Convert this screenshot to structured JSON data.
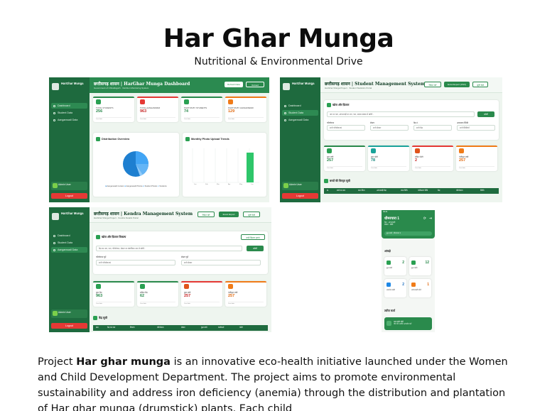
{
  "title": "Har Ghar Munga",
  "subtitle": "Nutritional & Environmental Drive",
  "colors": {
    "primary": "#2a8a4c",
    "sidebar": "#1e6a3e",
    "danger": "#e53935",
    "teal": "#1aa39a",
    "orange": "#f07b18",
    "blue": "#1e88e5"
  },
  "sidebar": {
    "brand": "HarGhar Munga",
    "brand_sub": "Admin Panel",
    "items": [
      "Dashboard",
      "Student Data",
      "Aanganwadi Data"
    ],
    "user_name": "Admin User",
    "user_role": "System Administrator",
    "logout": "Logout"
  },
  "shot1": {
    "title": "छत्तीसगढ़ शासन | HarGhar Munga Dashboard",
    "subtitle": "Government of Chhattisgarh · Nutrition Monitoring System",
    "btn_refresh": "Refresh Data",
    "btn_reload": "Reload",
    "stats": [
      {
        "label": "TOTAL STUDENTS",
        "value": "256"
      },
      {
        "label": "TOTAL AANGANWADI",
        "value": "963"
      },
      {
        "label": "PHOTOS BY STUDENTS",
        "value": "74"
      },
      {
        "label": "PHOTOS BY AANGANWADI",
        "value": "129"
      }
    ],
    "stat_foot": "Live data",
    "dist_title": "Distribution Overview",
    "legend": [
      "Aanganwadi Centers",
      "Aanganwadi Photos",
      "Student Photos",
      "Students"
    ],
    "trend_title": "Monthly Photo Upload Trends",
    "months": [
      "Jan",
      "Feb",
      "Mar",
      "Apr",
      "May",
      "Jun"
    ]
  },
  "shot2": {
    "title": "छत्तीसगढ़ शासन | Student Management System",
    "subtitle": "HarGhar Munga Project · Student Statistics Portal",
    "btn_refresh": "रिफ्रेश करें",
    "btn_export": "Excel Export (CSV)",
    "btn_list": "सूची देखें",
    "filter_title": "खोज और फ़िल्टर",
    "search_placeholder": "नाम या पता, आंगनवाड़ी या नाम, पता, सदस्य संख्या से खोजें...",
    "search_btn": "खोजें",
    "filters": [
      {
        "label": "परियोजना",
        "value": "सभी परियोजनाएं"
      },
      {
        "label": "सेक्टर",
        "value": "सभी सेक्टर"
      },
      {
        "label": "केंद्र नं.",
        "value": "सभी केंद्र"
      },
      {
        "label": "आवश्यक स्थिति",
        "value": "सभी स्थितियाँ"
      }
    ],
    "stats": [
      {
        "label": "कुल बच्चे",
        "value": "257"
      },
      {
        "label": "कुल फोटो",
        "value": "78"
      },
      {
        "label": "लंबित फोटो",
        "value": "2"
      },
      {
        "label": "पंजीकृत बच्चे",
        "value": "257"
      }
    ],
    "stat_foot": "Live data",
    "table_title": "बच्चों की विस्तृत सूची",
    "columns": [
      "क्र.",
      "बच्चे का नाम",
      "माता पिता",
      "आंगनवाड़ी केंद्र",
      "जन्म तिथि",
      "पंजीकरण तिथि",
      "केंद्र",
      "परियोजना",
      "स्थिति"
    ]
  },
  "shot3": {
    "title": "छत्तीसगढ़ शासन | Kendra Management System",
    "subtitle": "HarGhar Munga Project · Kendra Details Portal",
    "btn_refresh": "रिफ्रेश करें",
    "btn_export": "Excel Export",
    "btn_list": "सूची देखें",
    "filter_title": "खोज और फ़िल्टर विकल्प",
    "filter_btn": "सभी फ़िल्टर हटाएं",
    "search_placeholder": "केंद्र का नाम, पता, परियोजना, सेक्टर या संचालिका नाम से खोजें...",
    "search_btn": "खोजें",
    "filters": [
      {
        "label": "परियोजना चुनें",
        "value": "सभी परियोजनाएं"
      },
      {
        "label": "सेक्टर चुनें",
        "value": "सभी सेक्टर"
      }
    ],
    "stats": [
      {
        "label": "कुल केंद्र",
        "value": "963"
      },
      {
        "label": "सक्रिय केंद्र",
        "value": "62"
      },
      {
        "label": "कुल बच्चे",
        "value": "257"
      },
      {
        "label": "पंजीकृत बच्चे",
        "value": "257"
      }
    ],
    "stat_foot": "Live data",
    "table_title": "केंद्र सूची",
    "columns": [
      "क्रम",
      "केंद्र का नाम",
      "विवरण",
      "परियोजना",
      "सेक्टर",
      "कुल बच्चे",
      "कार्यकर्ता",
      "फोटो"
    ]
  },
  "shot4": {
    "status": "09:41",
    "name": "धीमरपारा 1",
    "sub1": "केंद्र : आंगनवाड़ी",
    "sub2": "सेक्टर : सीबी",
    "pill": "कुल बच्चे : धीमरपारा 1",
    "stats_title": "आंकड़े",
    "stats": [
      {
        "label": "कुल बच्चे",
        "value": "2"
      },
      {
        "label": "कुल फोटो",
        "value": "12"
      },
      {
        "label": "अपलोड बाकी",
        "value": "2"
      },
      {
        "label": "आंगनवाड़ी फोटो",
        "value": "1"
      }
    ],
    "actions_title": "त्वरित कार्य",
    "action_label": "नया फ़ोटो जोड़ें",
    "action_sub": "पौधे की तस्वीर अपलोड करें"
  },
  "caption": {
    "prefix": "Project ",
    "bold": "Har ghar munga",
    "rest": " is an innovative eco-health initiative launched under the Women and Child Development Department. The project aims to promote environmental sustainability and address iron deficiency (anemia) through the distribution and plantation of Har ghar munga (drumstick) plants. Each child"
  }
}
